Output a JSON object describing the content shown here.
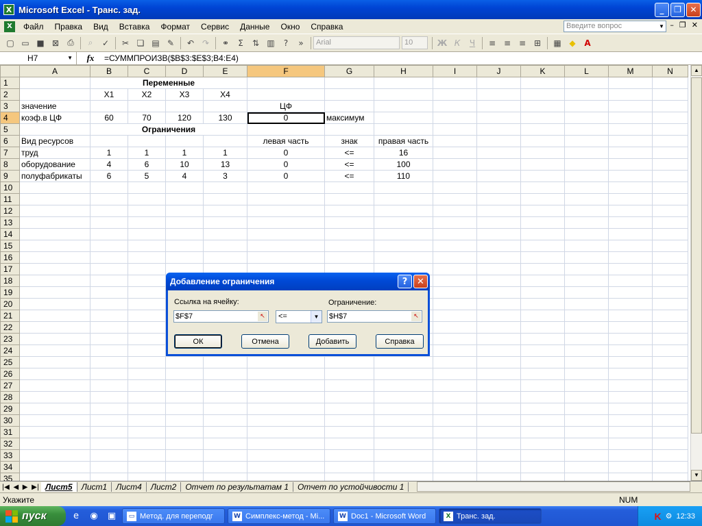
{
  "window": {
    "title": "Microsoft Excel - Транс. зад.",
    "min": "_",
    "restore": "❐",
    "close": "✕"
  },
  "menu": {
    "items": [
      "Файл",
      "Правка",
      "Вид",
      "Вставка",
      "Формат",
      "Сервис",
      "Данные",
      "Окно",
      "Справка"
    ],
    "ask_placeholder": "Введите вопрос",
    "doc_controls": [
      "–",
      "❐",
      "✕"
    ]
  },
  "toolbar": {
    "font": "Arial",
    "size": "10",
    "bold": "Ж",
    "italic": "К",
    "underline": "Ч"
  },
  "formula_bar": {
    "name_box": "H7",
    "fx": "fx",
    "formula": "=СУММПРОИЗВ($B$3:$E$3;B4:E4)"
  },
  "columns": [
    "A",
    "B",
    "C",
    "D",
    "E",
    "F",
    "G",
    "H",
    "I",
    "J",
    "K",
    "L",
    "M",
    "N"
  ],
  "cells": {
    "r1": {
      "B_E": "Переменные"
    },
    "r2": {
      "B": "X1",
      "C": "X2",
      "D": "X3",
      "E": "X4"
    },
    "r3": {
      "A": "значение",
      "F": "ЦФ"
    },
    "r4": {
      "A": "коэф.в ЦФ",
      "B": "60",
      "C": "70",
      "D": "120",
      "E": "130",
      "F": "0",
      "G": "максимум"
    },
    "r5": {
      "B_E": "Ограничения"
    },
    "r6": {
      "A": "Вид ресурсов",
      "F": "левая часть",
      "G": "знак",
      "H": "правая часть"
    },
    "r7": {
      "A": "труд",
      "B": "1",
      "C": "1",
      "D": "1",
      "E": "1",
      "F": "0",
      "G": "<=",
      "H": "16"
    },
    "r8": {
      "A": "оборудование",
      "B": "4",
      "C": "6",
      "D": "10",
      "E": "13",
      "F": "0",
      "G": "<=",
      "H": "100"
    },
    "r9": {
      "A": "полуфабрикаты",
      "B": "6",
      "C": "5",
      "D": "4",
      "E": "3",
      "F": "0",
      "G": "<=",
      "H": "110"
    }
  },
  "sheet_tabs": [
    "Лист5",
    "Лист1",
    "Лист4",
    "Лист2",
    "Отчет по результатам 1",
    "Отчет по устойчивости 1"
  ],
  "status": {
    "left": "Укажите",
    "num": "NUM"
  },
  "dialog": {
    "title": "Добавление ограничения",
    "cell_ref_label": "Ссылка на ячейку:",
    "cell_ref_value": "$F$7",
    "operator": "<=",
    "constraint_label": "Ограничение:",
    "constraint_value": "$H$7",
    "ok": "ОК",
    "cancel": "Отмена",
    "add": "Добавить",
    "help": "Справка"
  },
  "taskbar": {
    "start": "пуск",
    "tasks": [
      "Метод. для переподг",
      "Симплекс-метод - Mi...",
      "Doc1 - Microsoft Word",
      "Транс. зад."
    ],
    "clock": "12:33"
  }
}
